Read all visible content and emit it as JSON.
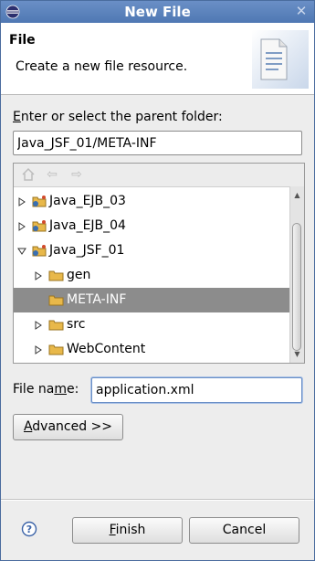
{
  "window": {
    "title": "New File"
  },
  "header": {
    "title": "File",
    "description": "Create a new file resource."
  },
  "folder": {
    "label_pre": "",
    "label_mnemonic": "E",
    "label_post": "nter or select the parent folder:",
    "value": "Java_JSF_01/META-INF"
  },
  "tree": {
    "items": [
      {
        "label": "Java_EJB_03",
        "level": 0,
        "expanded": false,
        "type": "project"
      },
      {
        "label": "Java_EJB_04",
        "level": 0,
        "expanded": false,
        "type": "project"
      },
      {
        "label": "Java_JSF_01",
        "level": 0,
        "expanded": true,
        "type": "project"
      },
      {
        "label": "gen",
        "level": 1,
        "expanded": false,
        "type": "folder"
      },
      {
        "label": "META-INF",
        "level": 1,
        "selected": true,
        "type": "folder"
      },
      {
        "label": "src",
        "level": 1,
        "expanded": false,
        "type": "folder"
      },
      {
        "label": "WebContent",
        "level": 1,
        "expanded": false,
        "type": "folder"
      }
    ]
  },
  "filename": {
    "label_pre": "File na",
    "label_mnemonic": "m",
    "label_post": "e:",
    "value": "application.xml"
  },
  "buttons": {
    "advanced_mnemonic": "A",
    "advanced_rest": "dvanced >>",
    "finish_mnemonic": "F",
    "finish_rest": "inish",
    "cancel": "Cancel"
  },
  "colors": {
    "titlebar": "#5a82bc",
    "selection": "#8c8c8c",
    "folder": "#e8b84a"
  }
}
